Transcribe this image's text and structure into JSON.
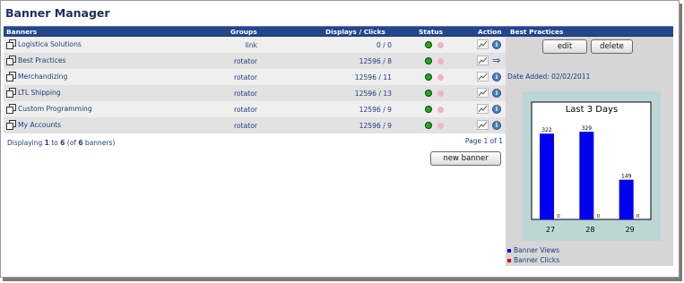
{
  "page": {
    "title": "Banner Manager"
  },
  "table": {
    "headers": {
      "banners": "Banners",
      "groups": "Groups",
      "displays": "Displays / Clicks",
      "status": "Status",
      "action": "Action"
    },
    "rows": [
      {
        "name": "Logistica Solutions",
        "group": "link",
        "displays_clicks": "0 / 0",
        "action": "stats"
      },
      {
        "name": "Best Practices",
        "group": "rotator",
        "displays_clicks": "12596 / 8",
        "action": "arrow"
      },
      {
        "name": "Merchandizing",
        "group": "rotator",
        "displays_clicks": "12596 / 11",
        "action": "info"
      },
      {
        "name": "LTL Shipping",
        "group": "rotator",
        "displays_clicks": "12596 / 13",
        "action": "info"
      },
      {
        "name": "Custom Programming",
        "group": "rotator",
        "displays_clicks": "12596 / 9",
        "action": "info"
      },
      {
        "name": "My Accounts",
        "group": "rotator",
        "displays_clicks": "12596 / 9",
        "action": "info"
      }
    ],
    "footer": {
      "prefix": "Displaying ",
      "from": "1",
      "to_word": " to ",
      "to": "6",
      "of_prefix": " (of ",
      "total": "6",
      "suffix": " banners)",
      "page": "Page 1 of 1"
    },
    "new_banner_label": "new banner"
  },
  "side": {
    "title": "Best Practices",
    "edit_label": "edit",
    "delete_label": "delete",
    "date_added": "Date Added: 02/02/2011",
    "legend": [
      {
        "label": "Banner Views",
        "color": "#0000ee"
      },
      {
        "label": "Banner Clicks",
        "color": "#ee0000"
      }
    ]
  },
  "chart_data": {
    "type": "bar",
    "title": "Last 3 Days",
    "categories": [
      "27",
      "28",
      "29"
    ],
    "series": [
      {
        "name": "Banner Views",
        "values": [
          322,
          329,
          149
        ],
        "color": "#0000ee"
      },
      {
        "name": "Banner Clicks",
        "values": [
          0,
          0,
          0
        ],
        "color": "#ee0000"
      }
    ],
    "ylim": [
      0,
      400
    ]
  },
  "colors": {
    "header": "#24468d",
    "link": "#1f3d7a",
    "status_on": "#16b016",
    "status_off": "#f2b4b8"
  }
}
